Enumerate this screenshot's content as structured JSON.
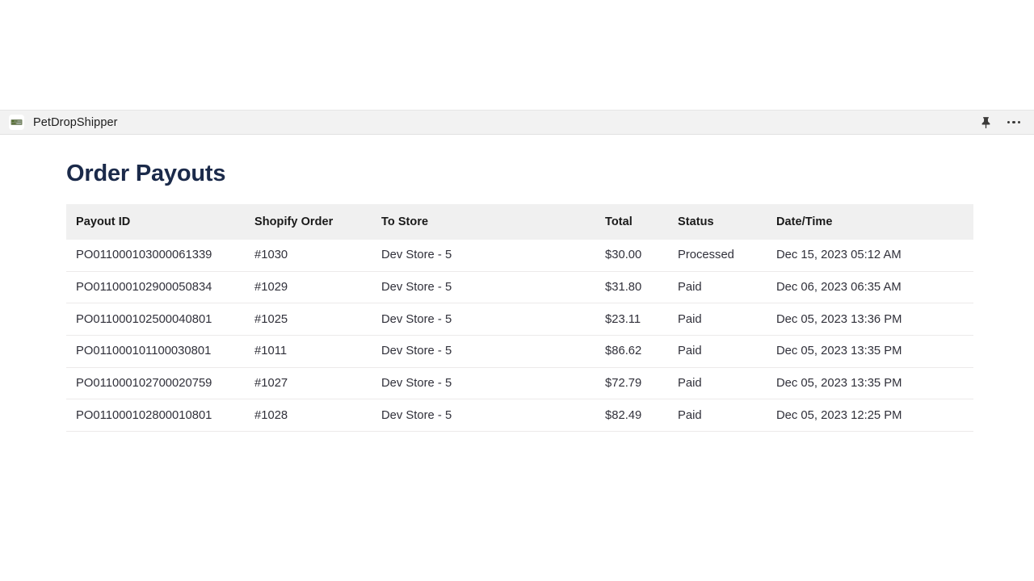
{
  "app_bar": {
    "app_name": "PetDropShipper",
    "app_icon": "app-logo-icon",
    "pin_icon": "pin-icon",
    "more_icon": "more-options-icon"
  },
  "page": {
    "title": "Order Payouts"
  },
  "table": {
    "columns": [
      "Payout ID",
      "Shopify Order",
      "To Store",
      "Total",
      "Status",
      "Date/Time"
    ],
    "rows": [
      {
        "payout_id": "PO011000103000061339",
        "shopify_order": "#1030",
        "to_store": "Dev Store - 5",
        "total": "$30.00",
        "status": "Processed",
        "status_kind": "processed",
        "datetime": "Dec 15, 2023 05:12 AM"
      },
      {
        "payout_id": "PO011000102900050834",
        "shopify_order": "#1029",
        "to_store": "Dev Store - 5",
        "total": "$31.80",
        "status": "Paid",
        "status_kind": "paid",
        "datetime": "Dec 06, 2023 06:35 AM"
      },
      {
        "payout_id": "PO011000102500040801",
        "shopify_order": "#1025",
        "to_store": "Dev Store - 5",
        "total": "$23.11",
        "status": "Paid",
        "status_kind": "paid",
        "datetime": "Dec 05, 2023 13:36 PM"
      },
      {
        "payout_id": "PO011000101100030801",
        "shopify_order": "#1011",
        "to_store": "Dev Store - 5",
        "total": "$86.62",
        "status": "Paid",
        "status_kind": "paid",
        "datetime": "Dec 05, 2023 13:35 PM"
      },
      {
        "payout_id": "PO011000102700020759",
        "shopify_order": "#1027",
        "to_store": "Dev Store - 5",
        "total": "$72.79",
        "status": "Paid",
        "status_kind": "paid",
        "datetime": "Dec 05, 2023 13:35 PM"
      },
      {
        "payout_id": "PO011000102800010801",
        "shopify_order": "#1028",
        "to_store": "Dev Store - 5",
        "total": "$82.49",
        "status": "Paid",
        "status_kind": "paid",
        "datetime": "Dec 05, 2023 12:25 PM"
      }
    ]
  },
  "colors": {
    "status_paid": "#1f7a1f",
    "status_processed": "#eda134",
    "title": "#1b2a4a",
    "app_bar_bg": "#f2f2f2",
    "header_bg": "#f0f0f0",
    "row_border": "#eceaea"
  }
}
